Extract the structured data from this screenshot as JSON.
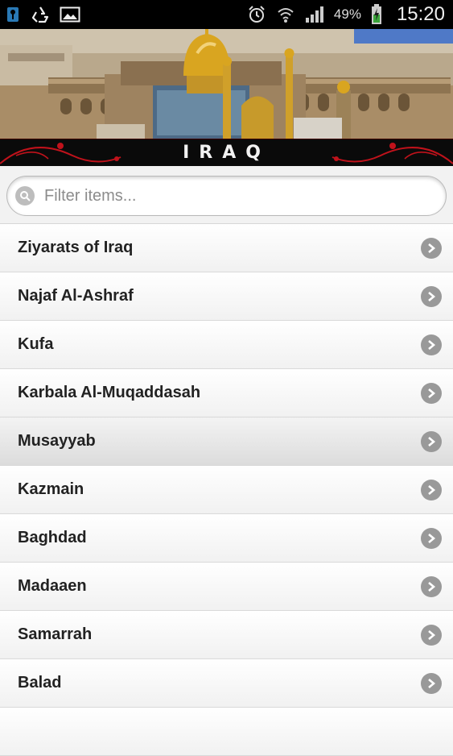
{
  "status_bar": {
    "battery_percent": "49%",
    "time": "15:20",
    "left_icons": [
      "signal-key-icon",
      "recycle-icon",
      "image-icon"
    ],
    "right_icons": [
      "alarm-icon",
      "wifi-icon",
      "signal-bars-icon",
      "battery-charging-icon"
    ]
  },
  "header": {
    "title": "IRAQ"
  },
  "search": {
    "placeholder": "Filter items..."
  },
  "list": {
    "items": [
      {
        "label": "Ziyarats of Iraq"
      },
      {
        "label": "Najaf Al-Ashraf"
      },
      {
        "label": "Kufa"
      },
      {
        "label": "Karbala Al-Muqaddasah"
      },
      {
        "label": "Musayyab"
      },
      {
        "label": "Kazmain"
      },
      {
        "label": "Baghdad"
      },
      {
        "label": "Madaaen"
      },
      {
        "label": "Samarrah"
      },
      {
        "label": "Balad"
      }
    ]
  },
  "colors": {
    "title_band": "#0a0a0a",
    "accent_red": "#c0121b",
    "dome_gold": "#d9a520",
    "chevron": "#999999"
  }
}
